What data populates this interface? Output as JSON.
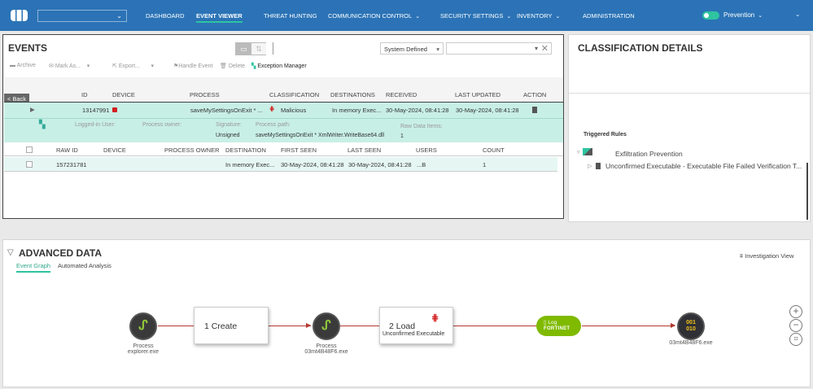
{
  "nav": {
    "items": [
      "DASHBOARD",
      "EVENT VIEWER",
      "THREAT HUNTING",
      "COMMUNICATION CONTROL",
      "SECURITY SETTINGS",
      "INVENTORY",
      "ADMINISTRATION"
    ],
    "mode": "Prevention"
  },
  "events": {
    "title": "EVENTS",
    "filter_select": "System Defined",
    "search_value": "",
    "toolbar": {
      "archive": "Archive",
      "mark_as": "Mark As...",
      "export": "Export...",
      "handle": "Handle Event",
      "delete": "Delete",
      "exception": "Exception Manager"
    },
    "back": "< Back",
    "columns": [
      "ID",
      "DEVICE",
      "PROCESS",
      "CLASSIFICATION",
      "DESTINATIONS",
      "RECEIVED",
      "LAST UPDATED",
      "ACTION"
    ],
    "row": {
      "id": "13147991",
      "process": "saveMySettingsOnExit * ...",
      "classification": "Malicious",
      "destinations": "In memory Exec...",
      "received": "30-May-2024, 08:41:28",
      "last_updated": "30-May-2024, 08:41:28"
    },
    "details": {
      "logged_in_user_label": "Logged-in User:",
      "process_owner_label": "Process owner:",
      "signature_label": "Signature:",
      "signature": "Unsigned",
      "process_path_label": "Process path:",
      "process_path": "saveMySettingsOnExit * XmlWriter.WriteBase64.dll",
      "raw_items_label": "Raw Data Items:",
      "raw_items": "1"
    },
    "raw_columns": [
      "RAW ID",
      "DEVICE",
      "PROCESS OWNER",
      "DESTINATION",
      "FIRST SEEN",
      "LAST SEEN",
      "USERS",
      "COUNT"
    ],
    "raw_row": {
      "raw_id": "157231781",
      "destination": "In memory Exec...",
      "first_seen": "30-May-2024, 08:41:28",
      "last_seen": "30-May-2024, 08:41:28",
      "users": "...B",
      "count": "1"
    }
  },
  "classification": {
    "title": "CLASSIFICATION DETAILS",
    "triggered": "Triggered Rules",
    "policy": "Exfiltration Prevention",
    "rule": "Unconfirmed Executable - Executable File Failed Verification T..."
  },
  "advanced": {
    "title": "ADVANCED DATA",
    "tabs": [
      "Event Graph",
      "Automated Analysis"
    ],
    "investigation": "Investigation View",
    "graph": {
      "n1_type": "Process",
      "n1_name": "explorer.exe",
      "e1": "1 Create",
      "n2_type": "Process",
      "n2_name": "03mt4B48F6.exe",
      "e2": "2 Load",
      "e2_sub": "Unconfirmed Executable",
      "log": "Log",
      "log_brand": "FORTINET",
      "n3_name": "03mt4B48F6.exe",
      "n3_glyph1": "001",
      "n3_glyph2": "010"
    }
  }
}
